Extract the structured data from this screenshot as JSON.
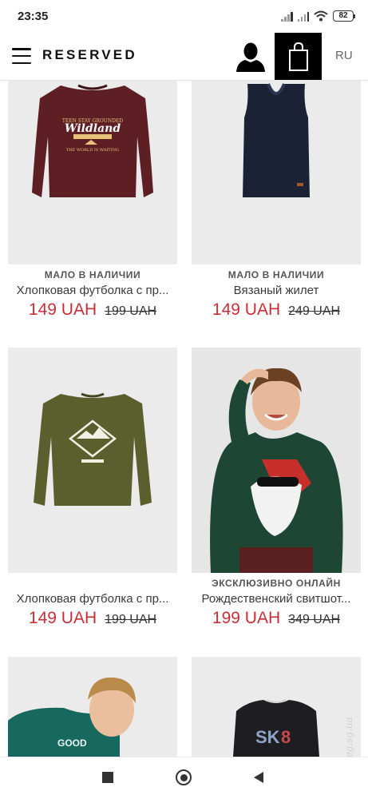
{
  "status_bar": {
    "time": "23:35",
    "battery": "82",
    "icons": [
      "signal-icon",
      "signal-icon",
      "wifi-icon",
      "battery-icon"
    ]
  },
  "header": {
    "menu_icon": "menu-icon",
    "brand": "RESERVED",
    "account_icon": "user-icon",
    "cart_icon": "shopping-bag-icon",
    "language": "RU"
  },
  "products": [
    {
      "badge": "МАЛО В НАЛИЧИИ",
      "name": "Хлопковая футболка с пр...",
      "price": "149 UAH",
      "old_price": "199 UAH",
      "image": "Wildland burgundy long-sleeve tee"
    },
    {
      "badge": "МАЛО В НАЛИЧИИ",
      "name": "Вязаный жилет",
      "price": "149 UAH",
      "old_price": "249 UAH",
      "image": "navy knit vest"
    },
    {
      "badge": "",
      "name": "Хлопковая футболка с пр...",
      "price": "149 UAH",
      "old_price": "199 UAH",
      "image": "olive long-sleeve tee with mountain print"
    },
    {
      "badge": "ЭКСКЛЮЗИВНО ОНЛАЙН",
      "name": "Рождественский свитшот...",
      "price": "199 UAH",
      "old_price": "349 UAH",
      "image": "boy in green Christmas sweatshirt"
    },
    {
      "badge": "",
      "name": "",
      "price": "",
      "old_price": "",
      "image": "boy in teal sweatshirt"
    },
    {
      "badge": "",
      "name": "",
      "price": "",
      "old_price": "",
      "image": "black sweatshirt SK8 print"
    }
  ],
  "nav_bar": {
    "recents_icon": "square-icon",
    "home_icon": "circle-home-icon",
    "back_icon": "triangle-back-icon"
  },
  "watermark": "Ledieg.sg.ua",
  "colors": {
    "price_red": "#c92e36",
    "cart_bg": "#000000",
    "image_bg": "#ebebeb"
  }
}
